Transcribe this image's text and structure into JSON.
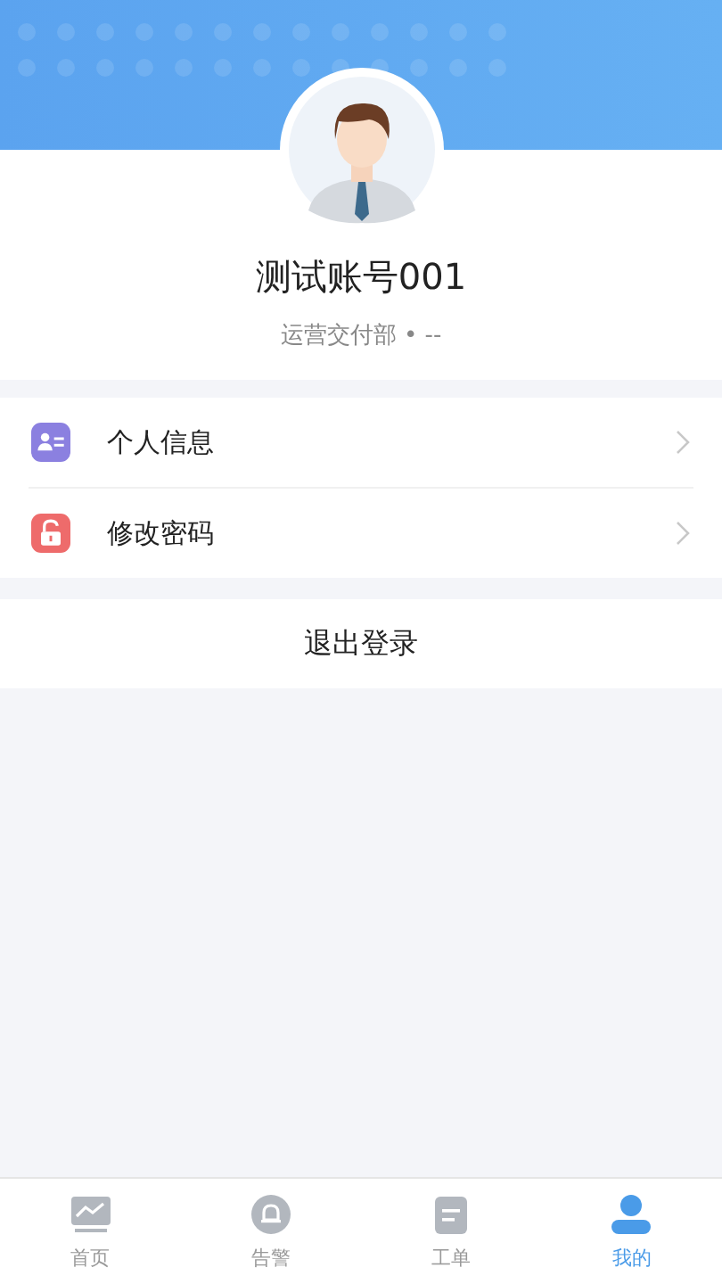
{
  "profile": {
    "name": "测试账号001",
    "department": "运营交付部 • --"
  },
  "menu": [
    {
      "kind": "profile",
      "label": "个人信息"
    },
    {
      "kind": "password",
      "label": "修改密码"
    }
  ],
  "logout": "退出登录",
  "tabs": [
    {
      "kind": "home",
      "label": "首页",
      "selected": false
    },
    {
      "kind": "alarm",
      "label": "告警",
      "selected": false
    },
    {
      "kind": "order",
      "label": "工单",
      "selected": false
    },
    {
      "kind": "me",
      "label": "我的",
      "selected": true
    }
  ]
}
